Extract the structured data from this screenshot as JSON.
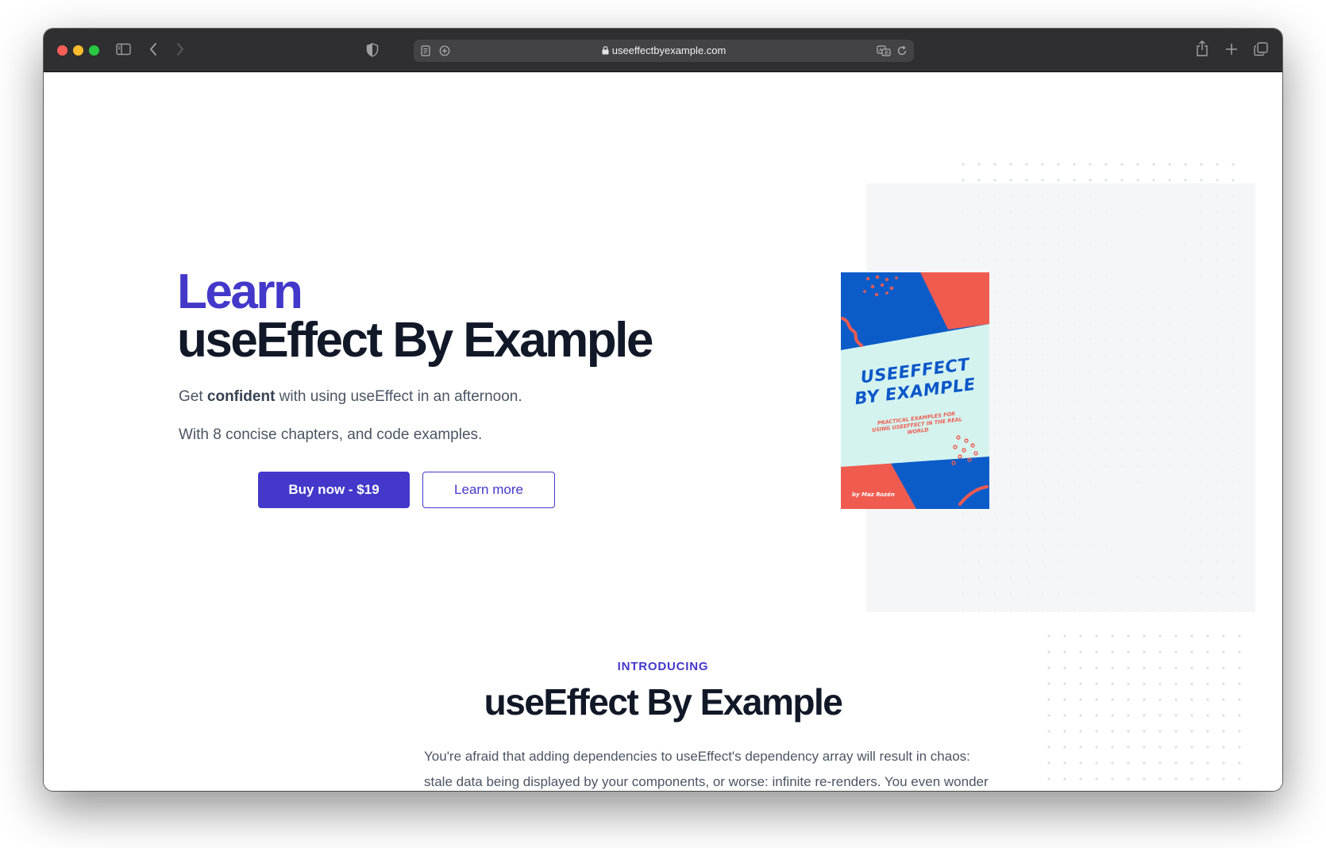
{
  "browser": {
    "url": "useeffectbyexample.com"
  },
  "hero": {
    "headline_accent": "Learn",
    "headline_main": "useEffect By Example",
    "subtitle_prefix": "Get ",
    "subtitle_bold": "confident",
    "subtitle_suffix": " with using useEffect in an afternoon.",
    "subtitle2": "With 8 concise chapters, and code examples.",
    "buy_button": "Buy now - $19",
    "learn_more_button": "Learn more"
  },
  "book_cover": {
    "title_line1": "USEEFFECT",
    "title_line2": "BY EXAMPLE",
    "subtitle": "PRACTICAL EXAMPLES FOR USING USEEFFECT IN THE REAL WORLD",
    "author": "by Maz Rozén"
  },
  "intro": {
    "label": "INTRODUCING",
    "title": "useEffect By Example",
    "body": "You're afraid that adding dependencies to useEffect's dependency array will result in chaos: stale data being displayed by your components, or worse: infinite re-renders. You even wonder if you should leave the code as it is. Telling the product manager that the"
  },
  "colors": {
    "accent": "#4338ca",
    "heading": "#111827",
    "body_text": "#4b5563",
    "cover_blue": "#0b5cc9",
    "cover_red": "#f05b4f",
    "cover_mint": "#d4f3ef"
  }
}
